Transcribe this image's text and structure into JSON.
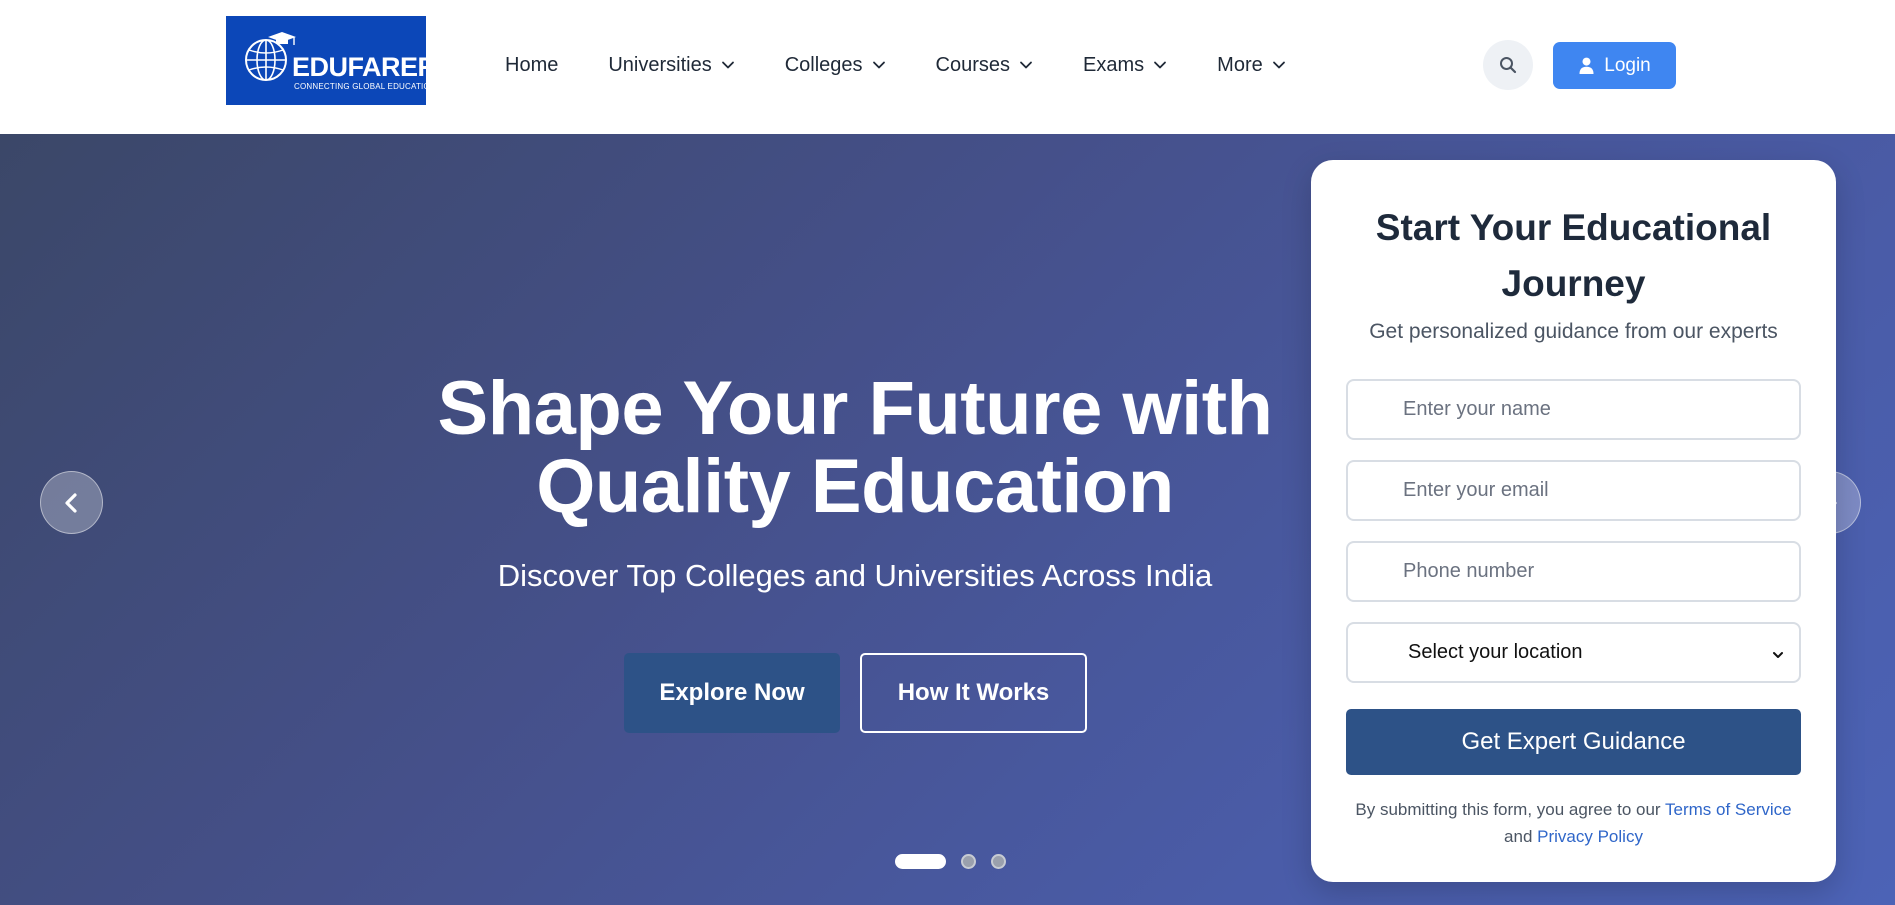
{
  "header": {
    "logo": {
      "brand": "EDUFARER",
      "tagline": "CONNECTING GLOBAL EDUCATION"
    },
    "nav": [
      {
        "label": "Home",
        "has_dropdown": false
      },
      {
        "label": "Universities",
        "has_dropdown": true
      },
      {
        "label": "Colleges",
        "has_dropdown": true
      },
      {
        "label": "Courses",
        "has_dropdown": true
      },
      {
        "label": "Exams",
        "has_dropdown": true
      },
      {
        "label": "More",
        "has_dropdown": true
      }
    ],
    "search_icon": "search-icon",
    "login_label": "Login",
    "login_icon": "user-icon"
  },
  "hero": {
    "title_line1": "Shape Your Future with",
    "title_line2": "Quality Education",
    "subtitle": "Discover Top Colleges and Universities Across India",
    "explore_label": "Explore Now",
    "how_label": "How It Works",
    "slides_total": 3,
    "active_slide": 1
  },
  "form": {
    "title_line1": "Start Your Educational",
    "title_line2": "Journey",
    "subtitle": "Get personalized guidance from our experts",
    "name_placeholder": "Enter your name",
    "email_placeholder": "Enter your email",
    "phone_placeholder": "Phone number",
    "location_selected": "Select your location",
    "submit_label": "Get Expert Guidance",
    "disclaimer_prefix": "By submitting this form, you agree to our ",
    "terms_label": "Terms of Service",
    "disclaimer_and": " and ",
    "privacy_label": "Privacy Policy"
  },
  "colors": {
    "logo_bg": "#0c47b8",
    "login_bg": "#3f86f1",
    "primary_dark": "#2d5287",
    "link": "#2f66c9"
  }
}
